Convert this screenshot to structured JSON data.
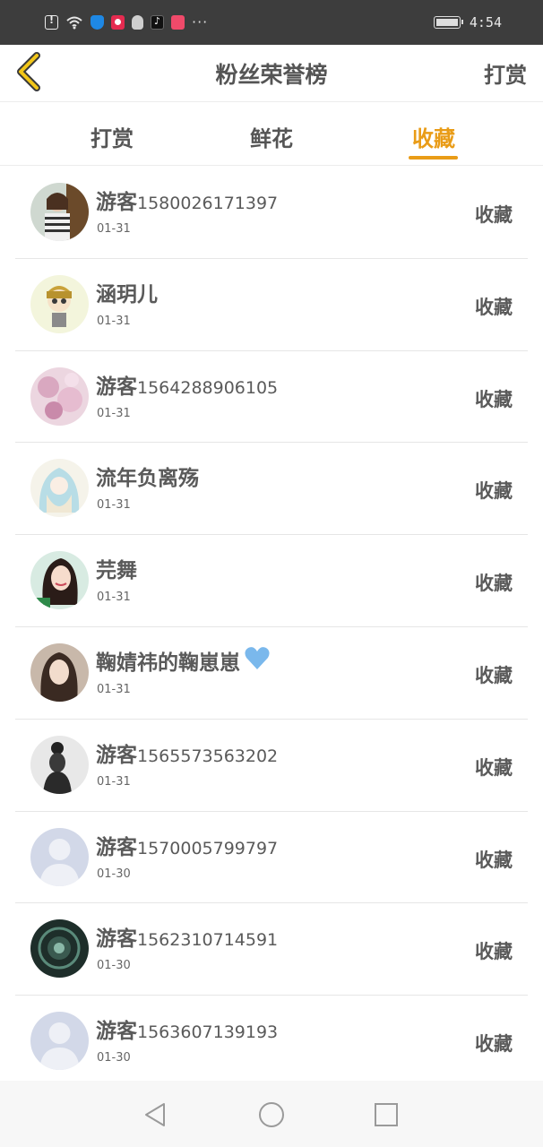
{
  "status_bar": {
    "time": "4:54",
    "icons": [
      "alert-icon",
      "wifi-icon",
      "shield-app-icon",
      "red-app-icon",
      "qq-icon",
      "tiktok-icon",
      "calendar-app-icon",
      "more-icon"
    ],
    "more": "···"
  },
  "header": {
    "title": "粉丝荣誉榜",
    "action": "打赏",
    "accent_color": "#e99c17"
  },
  "tabs": [
    {
      "label": "打赏",
      "active": false
    },
    {
      "label": "鲜花",
      "active": false
    },
    {
      "label": "收藏",
      "active": true
    }
  ],
  "list": [
    {
      "name": "游客",
      "num": "1580026171397",
      "date": "01-31",
      "action": "收藏",
      "avatar": "photo"
    },
    {
      "name": "涵玥儿",
      "num": "",
      "date": "01-31",
      "action": "收藏",
      "avatar": "cartoon"
    },
    {
      "name": "游客",
      "num": "1564288906105",
      "date": "01-31",
      "action": "收藏",
      "avatar": "pink-flowers"
    },
    {
      "name": "流年负离殇",
      "num": "",
      "date": "01-31",
      "action": "收藏",
      "avatar": "anime-girl"
    },
    {
      "name": "芫舞",
      "num": "",
      "date": "01-31",
      "action": "收藏",
      "avatar": "illustration"
    },
    {
      "name": "鞠婧祎的鞠崽崽",
      "num": "",
      "date": "01-31",
      "action": "收藏",
      "avatar": "photo-portrait",
      "emoji": "blue-heart-icon"
    },
    {
      "name": "游客",
      "num": "1565573563202",
      "date": "01-31",
      "action": "收藏",
      "avatar": "bw-portrait"
    },
    {
      "name": "游客",
      "num": "1570005799797",
      "date": "01-30",
      "action": "收藏",
      "avatar": "default"
    },
    {
      "name": "游客",
      "num": "1562310714591",
      "date": "01-30",
      "action": "收藏",
      "avatar": "dark-green"
    },
    {
      "name": "游客",
      "num": "1563607139193",
      "date": "01-30",
      "action": "收藏",
      "avatar": "default"
    }
  ],
  "nav": {
    "buttons": [
      "back-triangle-icon",
      "home-circle-icon",
      "recents-square-icon"
    ]
  }
}
